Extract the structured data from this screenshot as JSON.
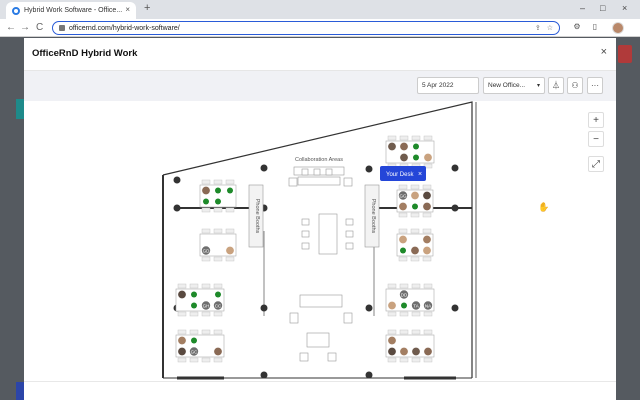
{
  "browser": {
    "tab_title": "Hybrid Work Software - Office...",
    "tab_close": "×",
    "new_tab": "+",
    "url": "officernd.com/hybrid-work-software/",
    "back": "←",
    "forward": "→",
    "reload": "C",
    "win_minimize": "–",
    "win_maximize": "□",
    "win_close": "×",
    "share_icon": "⇪",
    "star_icon": "☆",
    "ext_1": "⚙",
    "ext_2": "▯"
  },
  "modal": {
    "title": "OfficeRnD Hybrid Work",
    "close": "×",
    "date": "5 Apr 2022",
    "office": "New Office...",
    "office_caret": "▾",
    "filter_icon": "⏃",
    "people_icon": "⚇",
    "more_icon": "···",
    "zoom_in": "+",
    "zoom_out": "−",
    "fit_icon": "⤢"
  },
  "floorplan": {
    "collab_label": "Collaboration Areas",
    "phone_booths_left": "Phone Booths",
    "phone_booths_right": "Phone Booths",
    "your_desk": "Your Desk",
    "your_desk_close": "×",
    "initials": {
      "gd": "GD",
      "gh": "GH",
      "cc": "CC",
      "gc": "GC",
      "gg": "GG",
      "ta": "TA",
      "na": "NA",
      "dd": "DD"
    }
  },
  "colors": {
    "accent": "#2446d8",
    "available": "#1e8a2a",
    "wall": "#333333",
    "modal_toolbar": "#f0f1f5"
  }
}
